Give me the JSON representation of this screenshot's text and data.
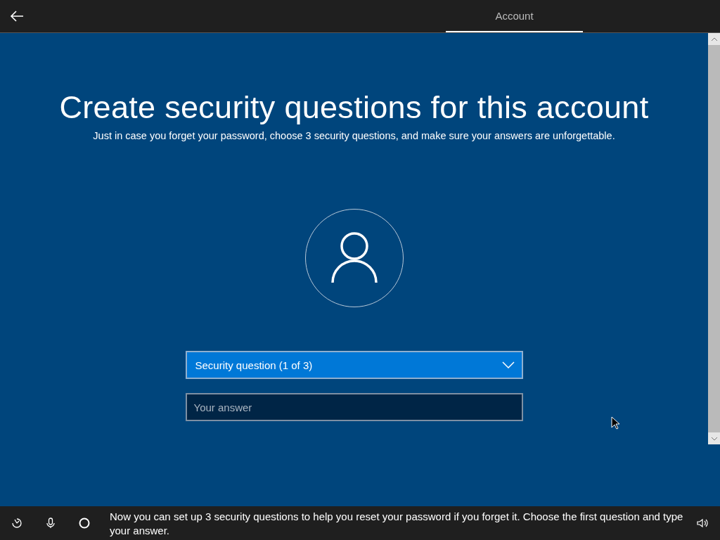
{
  "header": {
    "tabs": [
      {
        "label": "Account",
        "selected": true
      }
    ]
  },
  "page": {
    "title": "Create security questions for this account",
    "subtitle": "Just in case you forget your password, choose 3 security questions, and make sure your answers are unforgettable.",
    "question_dropdown": {
      "value": "Security question (1 of 3)"
    },
    "answer_field": {
      "placeholder": "Your answer"
    }
  },
  "taskbar": {
    "message": "Now you can set up 3 security questions to help you reset your password if you forget it. Choose the first question and type your answer."
  }
}
